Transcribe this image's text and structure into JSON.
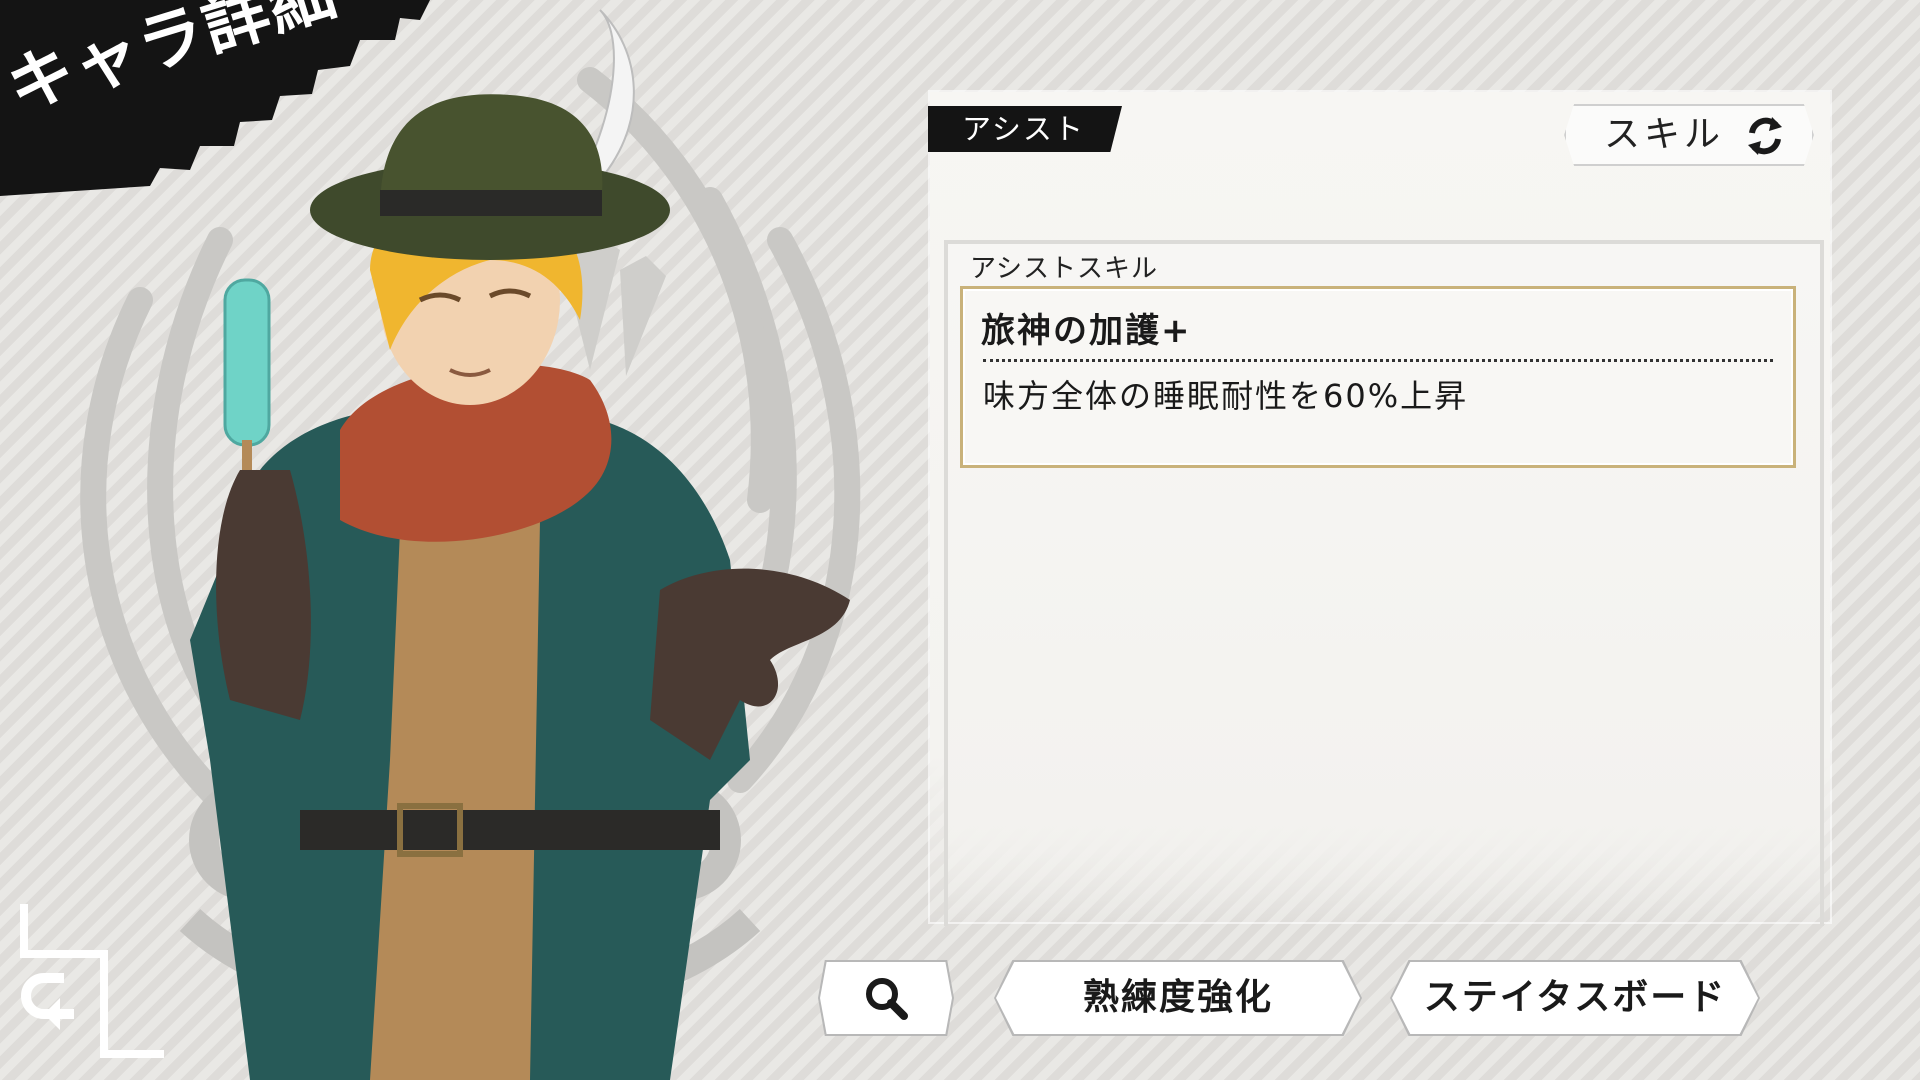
{
  "screen": {
    "title": "キャラ詳細"
  },
  "panel": {
    "tab_label": "アシスト",
    "toggle_label": "スキル",
    "section_label": "アシストスキル",
    "skill": {
      "name": "旅神の加護+",
      "description": "味方全体の睡眠耐性を60%上昇"
    }
  },
  "buttons": {
    "search_icon": "magnifier-icon",
    "mastery_label": "熟練度強化",
    "status_label": "ステイタスボード"
  },
  "icons": {
    "back": "return-arrow-icon",
    "swap": "swap-arrows-icon"
  },
  "colors": {
    "banner": "#141414",
    "skill_border": "#c9b27a"
  }
}
